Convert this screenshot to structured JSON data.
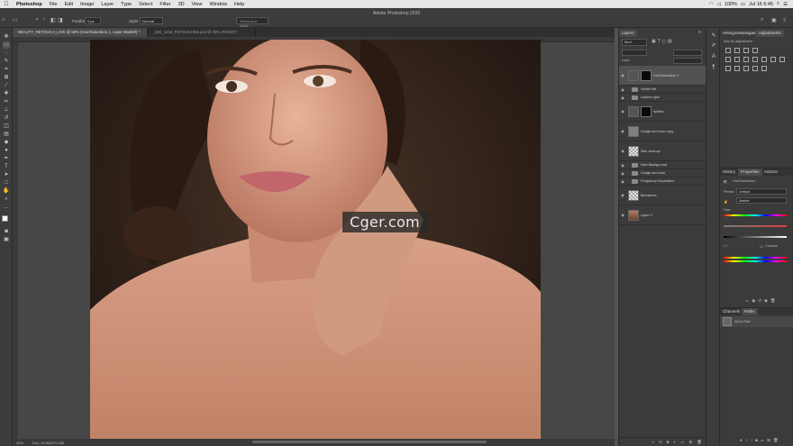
{
  "menubar": {
    "app": "Photoshop",
    "items": [
      "File",
      "Edit",
      "Image",
      "Layer",
      "Type",
      "Select",
      "Filter",
      "3D",
      "View",
      "Window",
      "Help"
    ],
    "battery": "100%",
    "clock": "Jul 16  5:45"
  },
  "window": {
    "title": "Adobe Photoshop 2020"
  },
  "options": {
    "feather_label": "Feather:",
    "feather_value": "0 px",
    "style_label": "Style:",
    "style_value": "Normal",
    "mask_button": "Select and Mask..."
  },
  "doc_tabs": [
    {
      "label": "BEAUTY_RETOUCH_LIVE @ 58% (Hue/Saturation 1, Layer Mask/8) *",
      "active": true
    },
    {
      "label": "_MG_1263_RETOUCHED.psd @ 25% (RGB/8*)",
      "active": false
    }
  ],
  "status": {
    "zoom": "40%",
    "doc": "Doc: 20.6M/471.5M"
  },
  "watermark": "Cger.com",
  "layers_panel": {
    "tabs": [
      "Layers"
    ],
    "filter": "Kind",
    "lock_label": "Lock:",
    "layers": [
      {
        "name": "Hue/Saturation 1",
        "type": "adjust",
        "selected": true
      },
      {
        "name": "Visible left",
        "type": "group"
      },
      {
        "name": "Lashes right",
        "type": "group"
      },
      {
        "name": "Whites",
        "type": "mask"
      },
      {
        "name": "Dodge and burn copy",
        "type": "gray"
      },
      {
        "name": "Skin cleanup",
        "type": "checker"
      },
      {
        "name": "New Background",
        "type": "group"
      },
      {
        "name": "Dodge and burn",
        "type": "group"
      },
      {
        "name": "Frequency Separation",
        "type": "group"
      },
      {
        "name": "Blemishes",
        "type": "checker"
      },
      {
        "name": "Layer 0",
        "type": "photo"
      }
    ]
  },
  "right_panel": {
    "top_tabs": [
      "Histogram",
      "Navigator",
      "Adjustments"
    ],
    "add_adjustment": "Add an adjustment",
    "mid_tabs": [
      "History",
      "Properties",
      "Actions"
    ],
    "properties_title": "Hue/Saturation",
    "preset_label": "Preset:",
    "preset_value": "Default",
    "channel_value": "Master",
    "hue_label": "Hue:",
    "colorize_label": "Colorize",
    "bottom_tabs": [
      "Channels",
      "Paths"
    ],
    "work_path": "Work Path"
  }
}
